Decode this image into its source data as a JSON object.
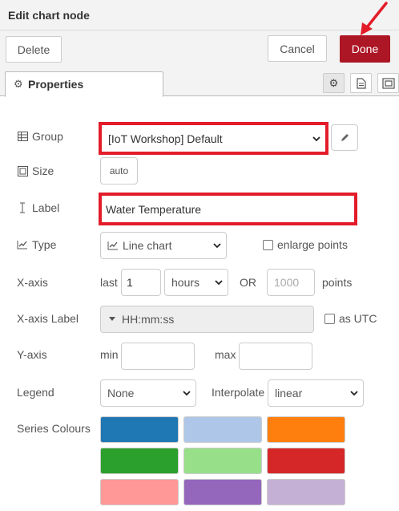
{
  "tray": {
    "title": "Edit chart node"
  },
  "toolbar": {
    "delete_label": "Delete",
    "cancel_label": "Cancel",
    "done_label": "Done"
  },
  "tabs": {
    "properties_label": "Properties"
  },
  "form": {
    "group": {
      "label": "Group",
      "value": "[IoT Workshop] Default"
    },
    "size": {
      "label": "Size",
      "value": "auto"
    },
    "label": {
      "label": "Label",
      "value": "Water Temperature"
    },
    "type": {
      "label": "Type",
      "value": "Line chart",
      "enlarge_label": "enlarge points"
    },
    "xaxis": {
      "label": "X-axis",
      "last_label": "last",
      "last_value": "1",
      "unit": "hours",
      "or_label": "OR",
      "points_placeholder": "1000",
      "points_label": "points"
    },
    "xaxis_label": {
      "label": "X-axis Label",
      "value": "HH:mm:ss",
      "utc_label": "as UTC"
    },
    "yaxis": {
      "label": "Y-axis",
      "min_label": "min",
      "max_label": "max"
    },
    "legend": {
      "label": "Legend",
      "value": "None",
      "interpolate_label": "Interpolate",
      "interpolate_value": "linear"
    },
    "series": {
      "label": "Series Colours"
    }
  },
  "colors": {
    "accent": "#AD1625",
    "highlight": "#e31c2a",
    "series": [
      "#1f77b4",
      "#aec7e8",
      "#ff7f0e",
      "#2ca02c",
      "#98df8a",
      "#d62728",
      "#ff9896",
      "#9467bd",
      "#c5b0d5"
    ]
  },
  "icons": {
    "group": "table-icon",
    "size": "resize-icon",
    "label": "text-cursor-icon",
    "type": "line-chart-icon",
    "edit": "pencil-icon",
    "gear": "gear-icon"
  }
}
